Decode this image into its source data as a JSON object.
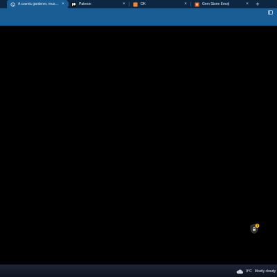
{
  "browser": {
    "tabs": [
      {
        "title": "A cosmic gardener, musing, pri...",
        "icon": "copilot-icon",
        "active": true,
        "close_label": "×"
      },
      {
        "title": "Patreon",
        "icon": "patreon-icon",
        "active": false,
        "close_label": "×"
      },
      {
        "title": "OK",
        "icon": "orange-page-icon",
        "active": false,
        "close_label": "×"
      },
      {
        "title": "Gem Stone Emoji",
        "icon": "emojipedia-icon",
        "active": false,
        "close_label": "×"
      }
    ],
    "new_tab_label": "+"
  },
  "taskbar": {
    "weather": {
      "temperature": "9°C",
      "condition": "Mostly cloudy",
      "icon": "cloud-icon"
    }
  },
  "colors": {
    "tabstrip": "#0d2742",
    "toolbar": "#1a5d94",
    "content": "#000000",
    "taskbar": "#161c2c"
  }
}
